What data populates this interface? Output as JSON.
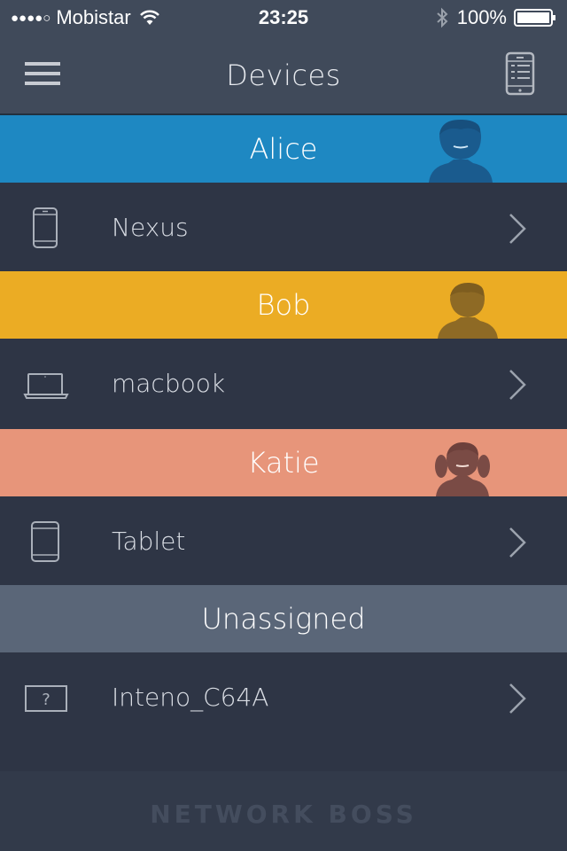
{
  "status_bar": {
    "signal": "●●●●○",
    "carrier": "Mobistar",
    "time": "23:25",
    "battery": "100%"
  },
  "nav": {
    "title": "Devices",
    "menu_icon": "hamburger-menu-icon",
    "right_icon": "device-list-icon"
  },
  "colors": {
    "alice": "#1e88c2",
    "bob": "#ebac24",
    "katie": "#e7957a",
    "unassigned": "#5a6678",
    "row_bg": "#2e3545"
  },
  "groups": [
    {
      "name": "Alice",
      "device": {
        "name": "Nexus",
        "icon": "smartphone-icon"
      }
    },
    {
      "name": "Bob",
      "device": {
        "name": "macbook",
        "icon": "laptop-icon"
      }
    },
    {
      "name": "Katie",
      "device": {
        "name": "Tablet",
        "icon": "tablet-icon"
      }
    },
    {
      "name": "Unassigned",
      "device": {
        "name": "Inteno_C64A",
        "icon": "unknown-device-icon"
      }
    }
  ],
  "footer": {
    "brand": "NETWORK BOSS"
  }
}
